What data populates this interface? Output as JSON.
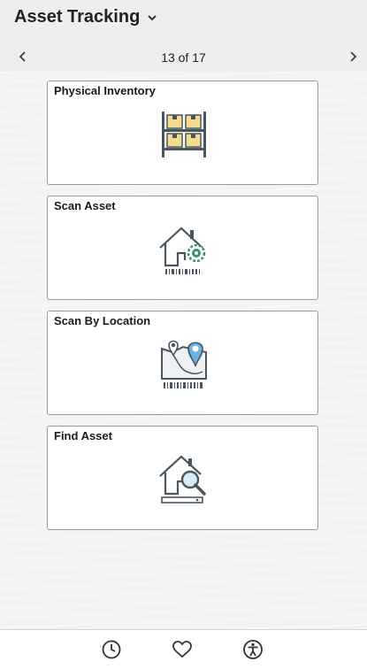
{
  "header": {
    "title": "Asset Tracking",
    "title_chevron_icon": "chevron-down-icon",
    "pager": {
      "text": "13 of 17",
      "prev_icon": "chevron-left-icon",
      "next_icon": "chevron-right-icon"
    }
  },
  "tiles": [
    {
      "label": "Physical Inventory",
      "icon": "warehouse-shelf-icon"
    },
    {
      "label": "Scan Asset",
      "icon": "house-gear-barcode-icon"
    },
    {
      "label": "Scan By Location",
      "icon": "map-pin-barcode-icon"
    },
    {
      "label": "Find Asset",
      "icon": "house-magnifier-icon"
    }
  ],
  "footer": {
    "buttons": [
      {
        "icon": "clock-icon",
        "meaning": "recently-visited"
      },
      {
        "icon": "heart-icon",
        "meaning": "favorites"
      },
      {
        "icon": "accessibility-icon",
        "meaning": "accessibility"
      }
    ]
  },
  "colors": {
    "header_bg": "#eeeeee",
    "page_bg": "#f4f3f1",
    "box_yellow": "#f6dc8d",
    "gear_teal": "#3a8f7a",
    "pin_blue": "#6fb3e0",
    "icon_gray": "#4a5560"
  }
}
